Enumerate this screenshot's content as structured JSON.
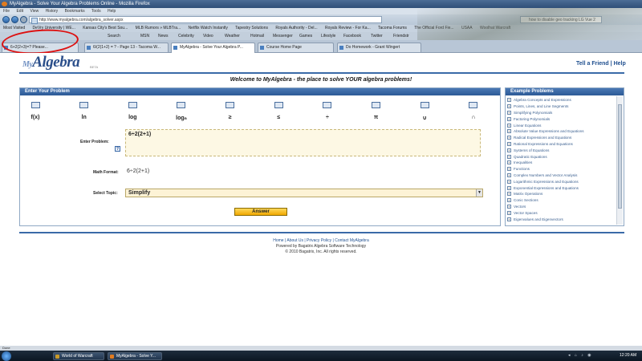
{
  "window": {
    "title": "MyAlgebra - Solve Your Algebra Problems Online - Mozilla Firefox"
  },
  "menu": [
    "File",
    "Edit",
    "View",
    "History",
    "Bookmarks",
    "Tools",
    "Help"
  ],
  "address": "http://www.myalgebra.com/algebra_solver.aspx",
  "search_text": "how to disable geo tracking LG Vue 2",
  "bookmarks": [
    "Most Visited",
    "DeVry University | WE...",
    "Kansas City's Best Sou...",
    "MLB Rumors » MLBTra...",
    "Netflix Watch Instantly",
    "Tapestry Solutions",
    "Royals Authority - Del...",
    "Royals Review - For Ka...",
    "Tacoma Forums",
    "The Official Ford Fie...",
    "USAA",
    "Woolhat Warcraft"
  ],
  "toolbar2": {
    "search_label": "Search",
    "items": [
      "MSN",
      "News",
      "Celebrity",
      "Video",
      "Weather",
      "Hotmail",
      "Messenger",
      "Games",
      "Lifestyle",
      "Facebook",
      "Twitter",
      "Friendstr"
    ]
  },
  "tabs": [
    "6+2(2+3)=? Please...",
    "6/(2(1+2) = ? - Page 13 - Tacoma W...",
    "MyAlgebra - Solve Your Algebra P...",
    "Course Home Page",
    "Do Homework - Grant Wingert"
  ],
  "site": {
    "logo_my": "My",
    "logo_main": "Algebra",
    "logo_beta": "BETA",
    "tell_friend": "Tell a Friend",
    "separator": "|",
    "help": "Help",
    "welcome": "Welcome to MyAlgebra - the place to solve YOUR algebra problems!"
  },
  "panel": {
    "title": "Enter Your Problem",
    "symbols_row2": [
      "f(x)",
      "ln",
      "log",
      "logₙ",
      "≥",
      "≤",
      "÷",
      "π",
      "∪",
      "∩"
    ],
    "enter_label": "Enter Problem:",
    "help_symbol": "?",
    "problem_value": "6÷2(2+1)",
    "math_label": "Math Format:",
    "math_value": "6÷2(2+1)",
    "topic_label": "Select Topic:",
    "topic_value": "Simplify",
    "answer_button": "Answer"
  },
  "examples": {
    "title": "Example Problems",
    "items": [
      "Algebra Concepts and Expressions",
      "Points, Lines, and Line Segments",
      "Simplifying Polynomials",
      "Factoring Polynomials",
      "Linear Equations",
      "Absolute Value Expressions and Equations",
      "Radical Expressions and Equations",
      "Rational Expressions and Equations",
      "Systems of Equations",
      "Quadratic Equations",
      "Inequalities",
      "Functions",
      "Complex Numbers and Vector Analysis",
      "Logarithmic Expressions and Equations",
      "Exponential Expressions and Equations",
      "Matrix Operations",
      "Conic Sections",
      "Vectors",
      "Vector Spaces",
      "Eigenvalues and Eigenvectors"
    ]
  },
  "footer": {
    "links": "Home | About Us | Privacy Policy | Contact MyAlgebra",
    "powered": "Powered by Bagatrix Algebra Software Technology",
    "copyright": "© 2010 Bagatrix, Inc. All rights reserved."
  },
  "status": "Done",
  "taskbar": {
    "items": [
      "World of Warcraft",
      "MyAlgebra - Solve Y..."
    ],
    "clock": "12:20 AM"
  }
}
